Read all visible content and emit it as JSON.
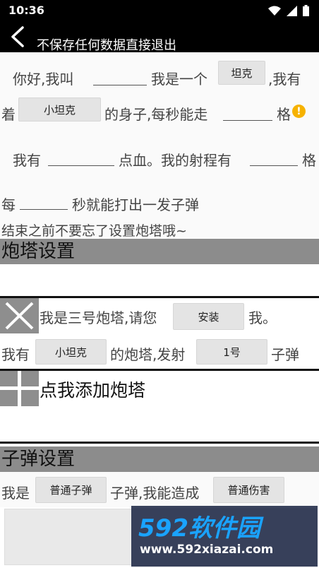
{
  "status": {
    "time": "10:36"
  },
  "appbar": {
    "title": "不保存任何数据直接退出"
  },
  "tank_form": {
    "hello": "你好,我叫",
    "i_am_a": "我是一个",
    "type_btn": "坦克",
    "i_have_suffix": ",我有",
    "have_prefix": "着",
    "body_btn": "小坦克",
    "body_suffix": "的身子,每秒能走",
    "grid_unit": "格",
    "hp_prefix": "我有",
    "hp_suffix": "点血。我的射程有",
    "range_unit": "格",
    "every": "每",
    "shoot_text": "秒就能打出一发子弹",
    "reminder": "结束之前不要忘了设置炮塔哦~"
  },
  "turret_section": {
    "header": "炮塔设置",
    "turret_text": "我是三号炮塔,请您",
    "install_btn": "安装",
    "me": "我。",
    "have_prefix": "我有",
    "turret_type_btn": "小坦克",
    "fire_text": "的炮塔,发射",
    "bullet_btn": "1号",
    "bullet_suffix": "子弹",
    "add_label": "点我添加炮塔"
  },
  "bullet_section": {
    "header": "子弹设置",
    "i_am": "我是",
    "bullet_type_btn": "普通子弹",
    "damage_text": "子弹,我能造成",
    "damage_btn": "普通伤害"
  },
  "watermark": {
    "brand": "592软件园",
    "url": "www.592xiazai.com"
  },
  "colors": {
    "header_gray": "#8c8c8c",
    "accent_warn": "#f6b200",
    "bar_black": "#000000"
  }
}
